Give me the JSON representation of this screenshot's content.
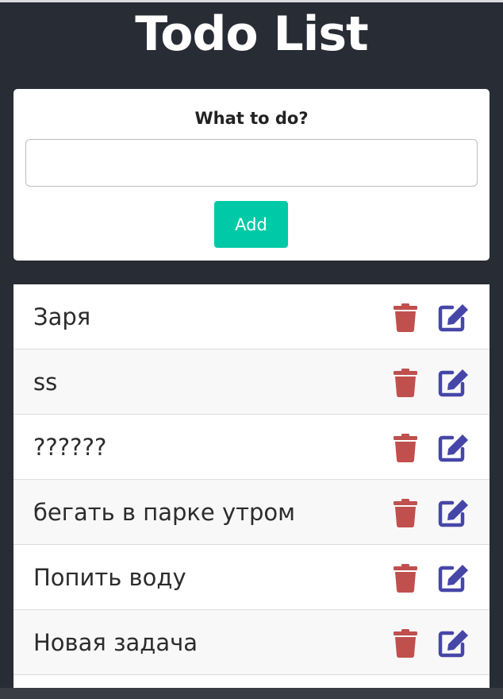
{
  "app": {
    "title": "Todo List"
  },
  "form": {
    "label": "What to do?",
    "input_value": "",
    "add_label": "Add"
  },
  "colors": {
    "background": "#282c34",
    "accent": "#00c9a7",
    "delete": "#c0504d",
    "edit": "#4646a8"
  },
  "icons": {
    "delete": "trash-icon",
    "edit": "edit-icon"
  },
  "todos": [
    {
      "text": "Заря"
    },
    {
      "text": "ss"
    },
    {
      "text": "??????"
    },
    {
      "text": "бегать в парке утром"
    },
    {
      "text": "Попить воду"
    },
    {
      "text": "Новая задача"
    }
  ]
}
